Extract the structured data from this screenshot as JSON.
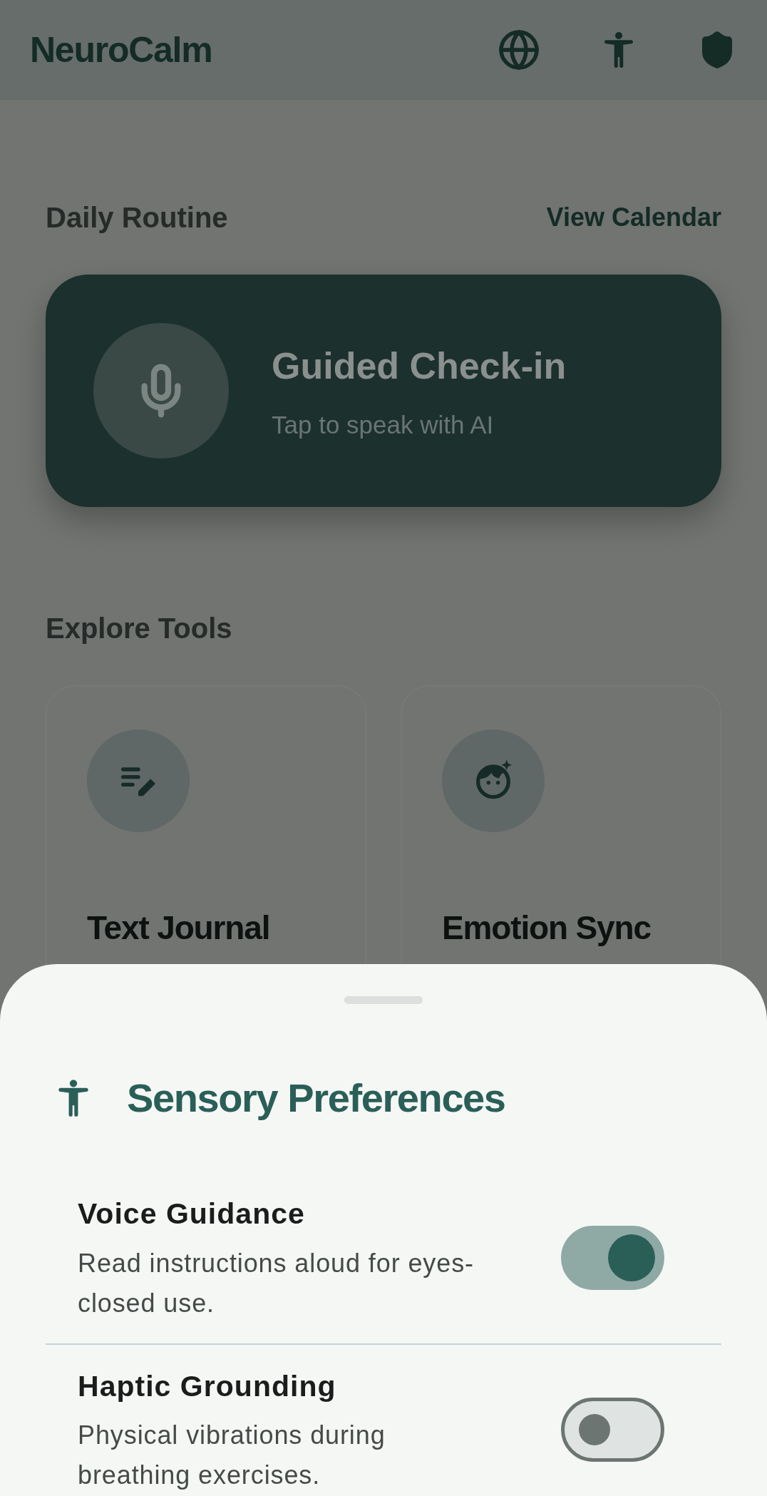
{
  "app_bar": {
    "title": "NeuroCalm"
  },
  "routine": {
    "heading": "Daily Routine",
    "link": "View Calendar",
    "card": {
      "title": "Guided Check-in",
      "subtitle": "Tap to speak with AI"
    }
  },
  "tools": {
    "heading": "Explore Tools",
    "items": [
      {
        "kind": "journal",
        "title": "Text Journal"
      },
      {
        "kind": "emotion",
        "title": "Emotion Sync"
      }
    ]
  },
  "sheet": {
    "title": "Sensory Preferences",
    "settings": [
      {
        "title": "Voice Guidance",
        "description": "Read instructions aloud for eyes-closed use.",
        "on": true
      },
      {
        "title": "Haptic Grounding",
        "description": "Physical vibrations during breathing exercises.",
        "on": false
      }
    ]
  }
}
